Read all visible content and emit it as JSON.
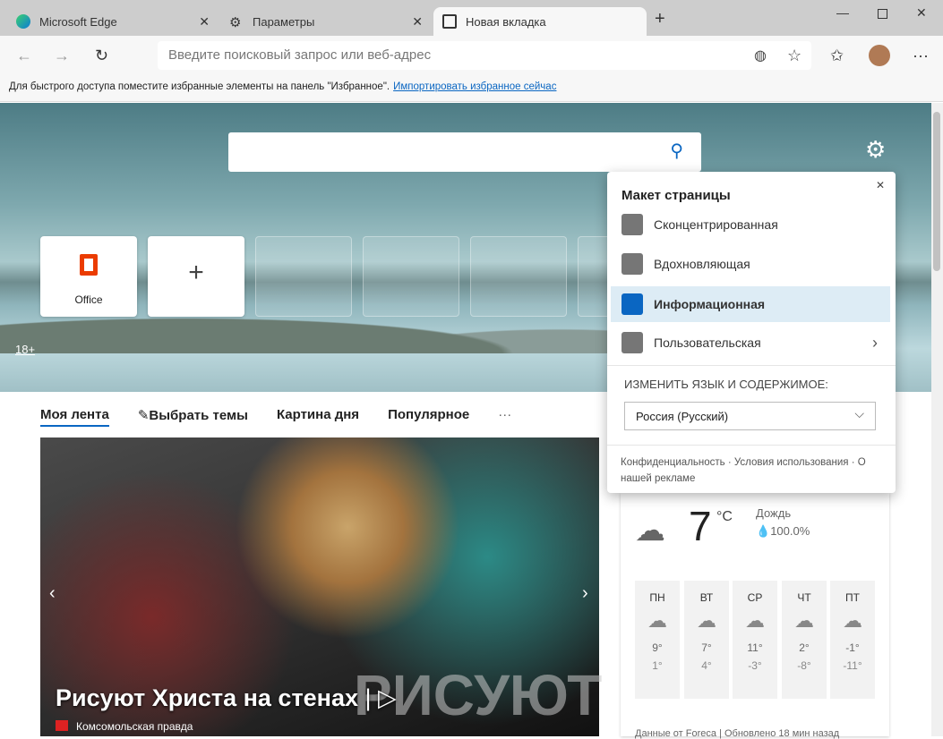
{
  "tabs": [
    {
      "title": "Microsoft Edge",
      "icon": "edge-logo-icon"
    },
    {
      "title": "Параметры",
      "icon": "gear-icon"
    },
    {
      "title": "Новая вкладка",
      "icon": "new-tab-icon",
      "active": true
    }
  ],
  "address": {
    "placeholder": "Введите поисковый запрос или веб-адрес"
  },
  "favorites_bar": {
    "text": "Для быстрого доступа поместите избранные элементы на панель \"Избранное\".",
    "link": "Импортировать избранное сейчас"
  },
  "hero": {
    "age_badge": "18+",
    "tiles": [
      {
        "label": "Office"
      },
      {
        "label": ""
      }
    ]
  },
  "feed": {
    "tabs": [
      "Моя лента",
      "Выбрать темы",
      "Картина дня",
      "Популярное"
    ],
    "more": "···",
    "headline": "Рисуют Христа на стенах",
    "source": "Комсомольская правда",
    "overlay_text": "РИСУЮТ"
  },
  "weather": {
    "temp": "7",
    "unit": "°C",
    "condition": "Дождь",
    "precip": "100.0%",
    "days": [
      {
        "d": "ПН",
        "hi": "9°",
        "lo": "1°"
      },
      {
        "d": "ВТ",
        "hi": "7°",
        "lo": "4°"
      },
      {
        "d": "СР",
        "hi": "11°",
        "lo": "-3°"
      },
      {
        "d": "ЧТ",
        "hi": "2°",
        "lo": "-8°"
      },
      {
        "d": "ПТ",
        "hi": "-1°",
        "lo": "-11°"
      }
    ],
    "footer": "Данные от Foreca | Обновлено 18 мин назад"
  },
  "panel": {
    "title": "Макет страницы",
    "options": [
      "Сконцентрированная",
      "Вдохновляющая",
      "Информационная",
      "Пользовательская"
    ],
    "selected": "Информационная",
    "lang_label": "ИЗМЕНИТЬ ЯЗЫК И СОДЕРЖИМОЕ:",
    "lang_value": "Россия (Русский)",
    "links": [
      "Конфиденциальность",
      "Условия использования",
      "О нашей рекламе"
    ]
  },
  "colors": {
    "accent": "#0a66c2",
    "office": "#eb3c00"
  }
}
